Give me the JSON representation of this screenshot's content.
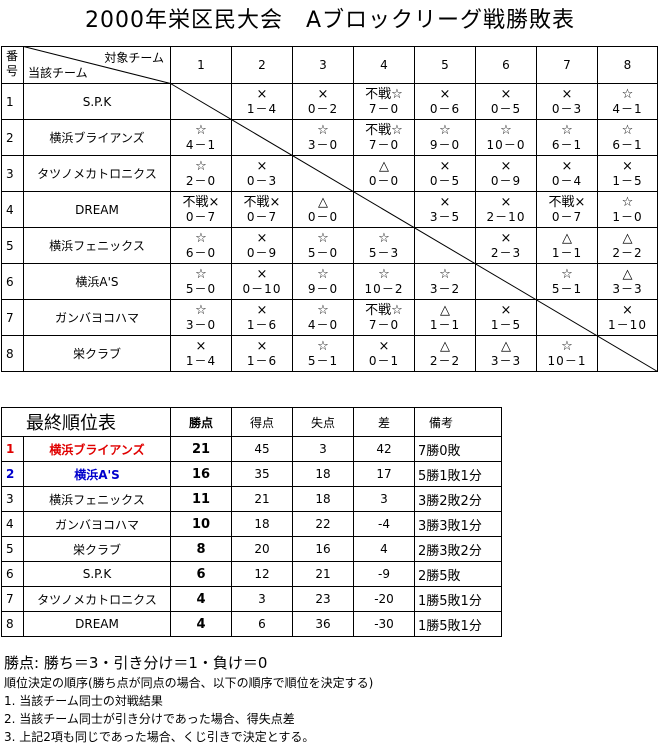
{
  "title": "2000年栄区民大会　Aブロックリーグ戦勝敗表",
  "league": {
    "header_num": "番\n号",
    "header_target": "対象チーム",
    "header_self": "当該チーム",
    "cols": [
      "1",
      "2",
      "3",
      "4",
      "5",
      "6",
      "7",
      "8"
    ],
    "rows": [
      {
        "no": "1",
        "team": "S.P.K",
        "cells": [
          null,
          {
            "s": "×",
            "r": "1－4"
          },
          {
            "s": "×",
            "r": "0－2"
          },
          {
            "s": "不戦☆",
            "r": "7－0"
          },
          {
            "s": "×",
            "r": "0－6"
          },
          {
            "s": "×",
            "r": "0－5"
          },
          {
            "s": "×",
            "r": "0－3"
          },
          {
            "s": "☆",
            "r": "4－1"
          }
        ]
      },
      {
        "no": "2",
        "team": "横浜ブライアンズ",
        "cells": [
          {
            "s": "☆",
            "r": "4－1"
          },
          null,
          {
            "s": "☆",
            "r": "3－0"
          },
          {
            "s": "不戦☆",
            "r": "7－0"
          },
          {
            "s": "☆",
            "r": "9－0"
          },
          {
            "s": "☆",
            "r": "10－0"
          },
          {
            "s": "☆",
            "r": "6－1"
          },
          {
            "s": "☆",
            "r": "6－1"
          }
        ]
      },
      {
        "no": "3",
        "team": "タツノメカトロニクス",
        "cells": [
          {
            "s": "☆",
            "r": "2－0"
          },
          {
            "s": "×",
            "r": "0－3"
          },
          null,
          {
            "s": "△",
            "r": "0－0"
          },
          {
            "s": "×",
            "r": "0－5"
          },
          {
            "s": "×",
            "r": "0－9"
          },
          {
            "s": "×",
            "r": "0－4"
          },
          {
            "s": "×",
            "r": "1－5"
          }
        ]
      },
      {
        "no": "4",
        "team": "DREAM",
        "cells": [
          {
            "s": "不戦×",
            "r": "0－7"
          },
          {
            "s": "不戦×",
            "r": "0－7"
          },
          {
            "s": "△",
            "r": "0－0"
          },
          null,
          {
            "s": "×",
            "r": "3－5"
          },
          {
            "s": "×",
            "r": "2－10"
          },
          {
            "s": "不戦×",
            "r": "0－7"
          },
          {
            "s": "☆",
            "r": "1－0"
          }
        ]
      },
      {
        "no": "5",
        "team": "横浜フェニックス",
        "cells": [
          {
            "s": "☆",
            "r": "6－0"
          },
          {
            "s": "×",
            "r": "0－9"
          },
          {
            "s": "☆",
            "r": "5－0"
          },
          {
            "s": "☆",
            "r": "5－3"
          },
          null,
          {
            "s": "×",
            "r": "2－3"
          },
          {
            "s": "△",
            "r": "1－1"
          },
          {
            "s": "△",
            "r": "2－2"
          }
        ]
      },
      {
        "no": "6",
        "team": "横浜A'S",
        "cells": [
          {
            "s": "☆",
            "r": "5－0"
          },
          {
            "s": "×",
            "r": "0－10"
          },
          {
            "s": "☆",
            "r": "9－0"
          },
          {
            "s": "☆",
            "r": "10－2"
          },
          {
            "s": "☆",
            "r": "3－2"
          },
          null,
          {
            "s": "☆",
            "r": "5－1"
          },
          {
            "s": "△",
            "r": "3－3"
          }
        ]
      },
      {
        "no": "7",
        "team": "ガンバヨコハマ",
        "cells": [
          {
            "s": "☆",
            "r": "3－0"
          },
          {
            "s": "×",
            "r": "1－6"
          },
          {
            "s": "☆",
            "r": "4－0"
          },
          {
            "s": "不戦☆",
            "r": "7－0"
          },
          {
            "s": "△",
            "r": "1－1"
          },
          {
            "s": "×",
            "r": "1－5"
          },
          null,
          {
            "s": "×",
            "r": "1－10"
          }
        ]
      },
      {
        "no": "8",
        "team": "栄クラブ",
        "cells": [
          {
            "s": "×",
            "r": "1－4"
          },
          {
            "s": "×",
            "r": "1－6"
          },
          {
            "s": "☆",
            "r": "5－1"
          },
          {
            "s": "×",
            "r": "0－1"
          },
          {
            "s": "△",
            "r": "2－2"
          },
          {
            "s": "△",
            "r": "3－3"
          },
          {
            "s": "☆",
            "r": "10－1"
          },
          null
        ]
      }
    ]
  },
  "ranking": {
    "title": "最終順位表",
    "headers": {
      "points": "勝点",
      "scored": "得点",
      "conceded": "失点",
      "diff": "差",
      "note": "備考"
    },
    "rows": [
      {
        "rank": "1",
        "team": "横浜ブライアンズ",
        "points": "21",
        "scored": "45",
        "conceded": "3",
        "diff": "42",
        "note": "7勝0敗",
        "style": "red"
      },
      {
        "rank": "2",
        "team": "横浜A'S",
        "points": "16",
        "scored": "35",
        "conceded": "18",
        "diff": "17",
        "note": "5勝1敗1分",
        "style": "blue"
      },
      {
        "rank": "3",
        "team": "横浜フェニックス",
        "points": "11",
        "scored": "21",
        "conceded": "18",
        "diff": "3",
        "note": "3勝2敗2分",
        "style": ""
      },
      {
        "rank": "4",
        "team": "ガンバヨコハマ",
        "points": "10",
        "scored": "18",
        "conceded": "22",
        "diff": "-4",
        "note": "3勝3敗1分",
        "style": ""
      },
      {
        "rank": "5",
        "team": "栄クラブ",
        "points": "8",
        "scored": "20",
        "conceded": "16",
        "diff": "4",
        "note": "2勝3敗2分",
        "style": ""
      },
      {
        "rank": "6",
        "team": "S.P.K",
        "points": "6",
        "scored": "12",
        "conceded": "21",
        "diff": "-9",
        "note": "2勝5敗",
        "style": ""
      },
      {
        "rank": "7",
        "team": "タツノメカトロニクス",
        "points": "4",
        "scored": "3",
        "conceded": "23",
        "diff": "-20",
        "note": "1勝5敗1分",
        "style": ""
      },
      {
        "rank": "8",
        "team": "DREAM",
        "points": "4",
        "scored": "6",
        "conceded": "36",
        "diff": "-30",
        "note": "1勝5敗1分",
        "style": ""
      }
    ]
  },
  "notes": {
    "points_rule": "勝点: 勝ち＝3・引き分け＝1・負け＝0",
    "order_rule": "順位決定の順序(勝ち点が同点の場合、以下の順序で順位を決定する)",
    "rule1": "1. 当該チーム同士の対戦結果",
    "rule2": "2. 当該チーム同士が引き分けであった場合、得失点差",
    "rule3": "3. 上記2項も同じであった場合、くじ引きで決定とする。"
  }
}
